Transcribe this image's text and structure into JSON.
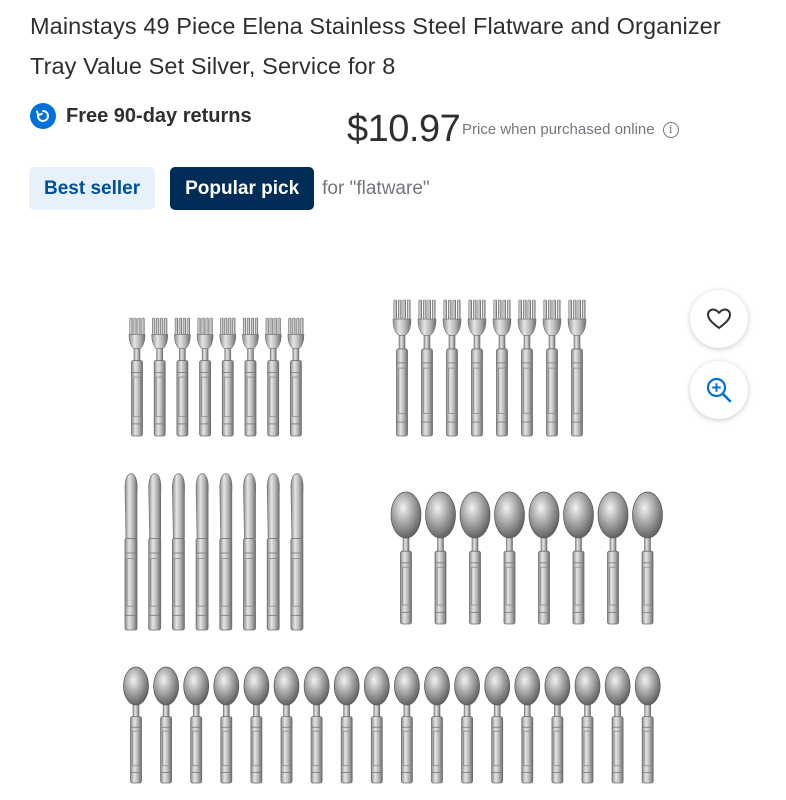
{
  "product": {
    "title": "Mainstays 49 Piece Elena Stainless Steel Flatware and Organizer Tray Value Set Silver, Service for 8",
    "returns_text": "Free 90-day returns",
    "price": "$10.97",
    "price_note": "Price when purchased online",
    "badges": {
      "best_seller": "Best seller",
      "popular_pick": "Popular pick",
      "popular_context": "for \"flatware\""
    }
  },
  "image": {
    "alt": "",
    "rows": {
      "salad_forks": 8,
      "dinner_forks": 8,
      "knives": 8,
      "soup_spoons": 8,
      "teaspoons": 18
    }
  },
  "actions": {
    "favorite_icon": "heart-icon",
    "zoom_icon": "zoom-in-icon"
  },
  "colors": {
    "brand_blue": "#0071dc",
    "badge_dark": "#002d58",
    "badge_light": "#e6f1fc",
    "text": "#2e2f32",
    "muted": "#74767c"
  }
}
